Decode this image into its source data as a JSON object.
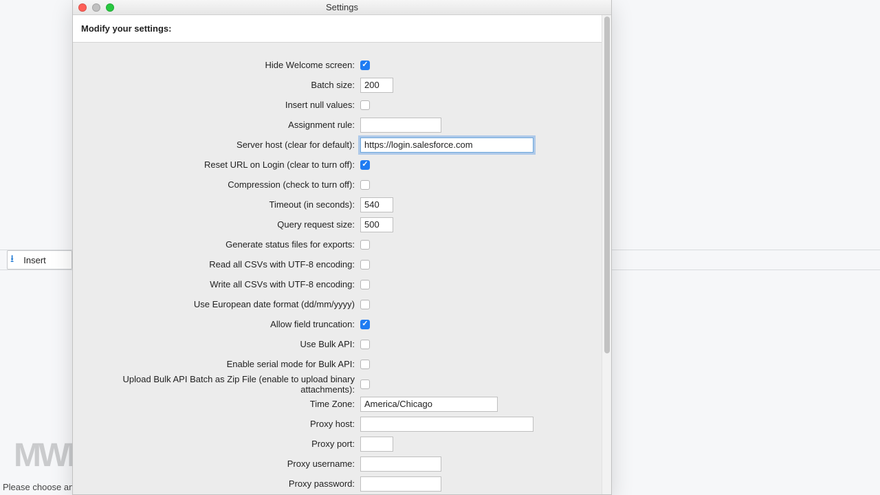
{
  "background": {
    "insert_label": "Insert",
    "status_text": "Please choose an",
    "watermark": "MWM"
  },
  "window": {
    "title": "Settings"
  },
  "heading": "Modify your settings:",
  "settings": {
    "hide_welcome": {
      "label": "Hide Welcome screen:",
      "checked": true
    },
    "batch_size": {
      "label": "Batch size:",
      "value": "200"
    },
    "insert_null": {
      "label": "Insert null values:",
      "checked": false
    },
    "assignment_rule": {
      "label": "Assignment rule:",
      "value": ""
    },
    "server_host": {
      "label": "Server host (clear for default):",
      "value": "https://login.salesforce.com"
    },
    "reset_url": {
      "label": "Reset URL on Login (clear to turn off):",
      "checked": true
    },
    "compression": {
      "label": "Compression (check to turn off):",
      "checked": false
    },
    "timeout": {
      "label": "Timeout (in seconds):",
      "value": "540"
    },
    "query_request_size": {
      "label": "Query request size:",
      "value": "500"
    },
    "status_files": {
      "label": "Generate status files for exports:",
      "checked": false
    },
    "read_utf8": {
      "label": "Read all CSVs with UTF-8 encoding:",
      "checked": false
    },
    "write_utf8": {
      "label": "Write all CSVs with UTF-8 encoding:",
      "checked": false
    },
    "euro_date": {
      "label": "Use European date format (dd/mm/yyyy)",
      "checked": false
    },
    "field_trunc": {
      "label": "Allow field truncation:",
      "checked": true
    },
    "bulk_api": {
      "label": "Use Bulk API:",
      "checked": false
    },
    "bulk_serial": {
      "label": "Enable serial mode for Bulk API:",
      "checked": false
    },
    "bulk_zip": {
      "label": "Upload Bulk API Batch as Zip File (enable to upload binary attachments):",
      "checked": false
    },
    "time_zone": {
      "label": "Time Zone:",
      "value": "America/Chicago"
    },
    "proxy_host": {
      "label": "Proxy host:",
      "value": ""
    },
    "proxy_port": {
      "label": "Proxy port:",
      "value": ""
    },
    "proxy_username": {
      "label": "Proxy username:",
      "value": ""
    },
    "proxy_password": {
      "label": "Proxy password:",
      "value": ""
    }
  }
}
